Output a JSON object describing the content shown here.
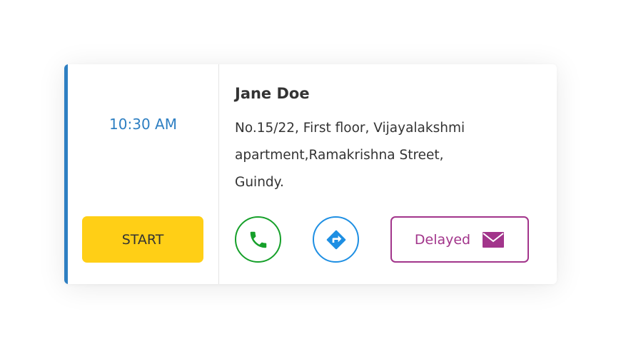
{
  "appointment": {
    "time": "10:30 AM",
    "start_label": "START",
    "customer_name": "Jane Doe",
    "address_lines": [
      "No.15/22, First floor, Vijayalakshmi",
      "apartment,Ramakrishna Street,",
      "Guindy."
    ],
    "delayed_label": "Delayed"
  },
  "icons": {
    "call": "phone-icon",
    "directions": "directions-icon",
    "delayed": "envelope-icon"
  },
  "colors": {
    "accent": "#2e7fc2",
    "start_button": "#ffcf16",
    "call": "#16a02a",
    "directions": "#1e8fe3",
    "delayed": "#a2358b"
  }
}
